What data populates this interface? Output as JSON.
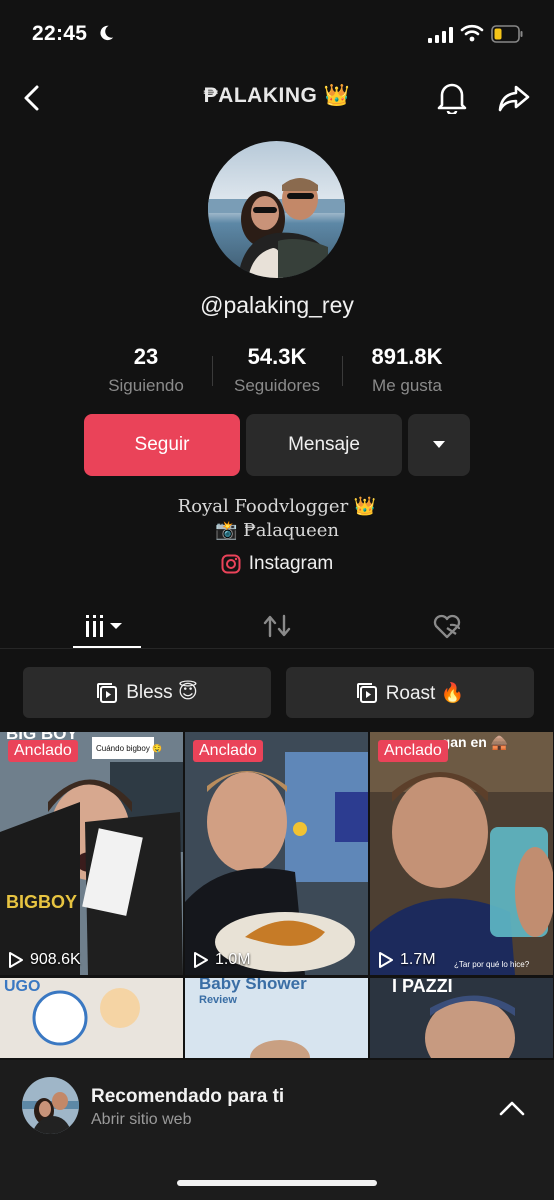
{
  "status": {
    "time": "22:45"
  },
  "header": {
    "title": "₱ALAKING 👑"
  },
  "profile": {
    "handle": "@palaking_rey",
    "stats": [
      {
        "value": "23",
        "label": "Siguiendo"
      },
      {
        "value": "54.3K",
        "label": "Seguidores"
      },
      {
        "value": "891.8K",
        "label": "Me gusta"
      }
    ],
    "buttons": {
      "follow": "Seguir",
      "message": "Mensaje"
    },
    "bio_line1": "Royal Foodvlogger 👑",
    "bio_line2": "📸 ₱alaqueen",
    "link": "Instagram"
  },
  "playlists": [
    {
      "label": "Bless 😇"
    },
    {
      "label": "Roast 🔥"
    }
  ],
  "videos": [
    {
      "pinned": "Anclado",
      "views": "908.6K",
      "overlay": "BIG BOY",
      "bag_text": "BIGBOY",
      "sub_text": "Cuándo bigboy 🤤"
    },
    {
      "pinned": "Anclado",
      "views": "1.0M",
      "overlay": "",
      "bag_text": "",
      "sub_text": ""
    },
    {
      "pinned": "Anclado",
      "views": "1.7M",
      "overlay": "...gan en 🛖",
      "bag_text": "",
      "sub_text": "¿Tar por qué lo hice?"
    },
    {
      "overlay": "UGO"
    },
    {
      "overlay": "Baby Shower",
      "sub_text": "Review"
    },
    {
      "overlay": "I PAZZI"
    }
  ],
  "recommendation": {
    "title": "Recomendado para ti",
    "subtitle": "Abrir sitio web"
  },
  "colors": {
    "accent": "#ea4359",
    "background": "#121212",
    "button_dark": "#2a2a2a"
  }
}
